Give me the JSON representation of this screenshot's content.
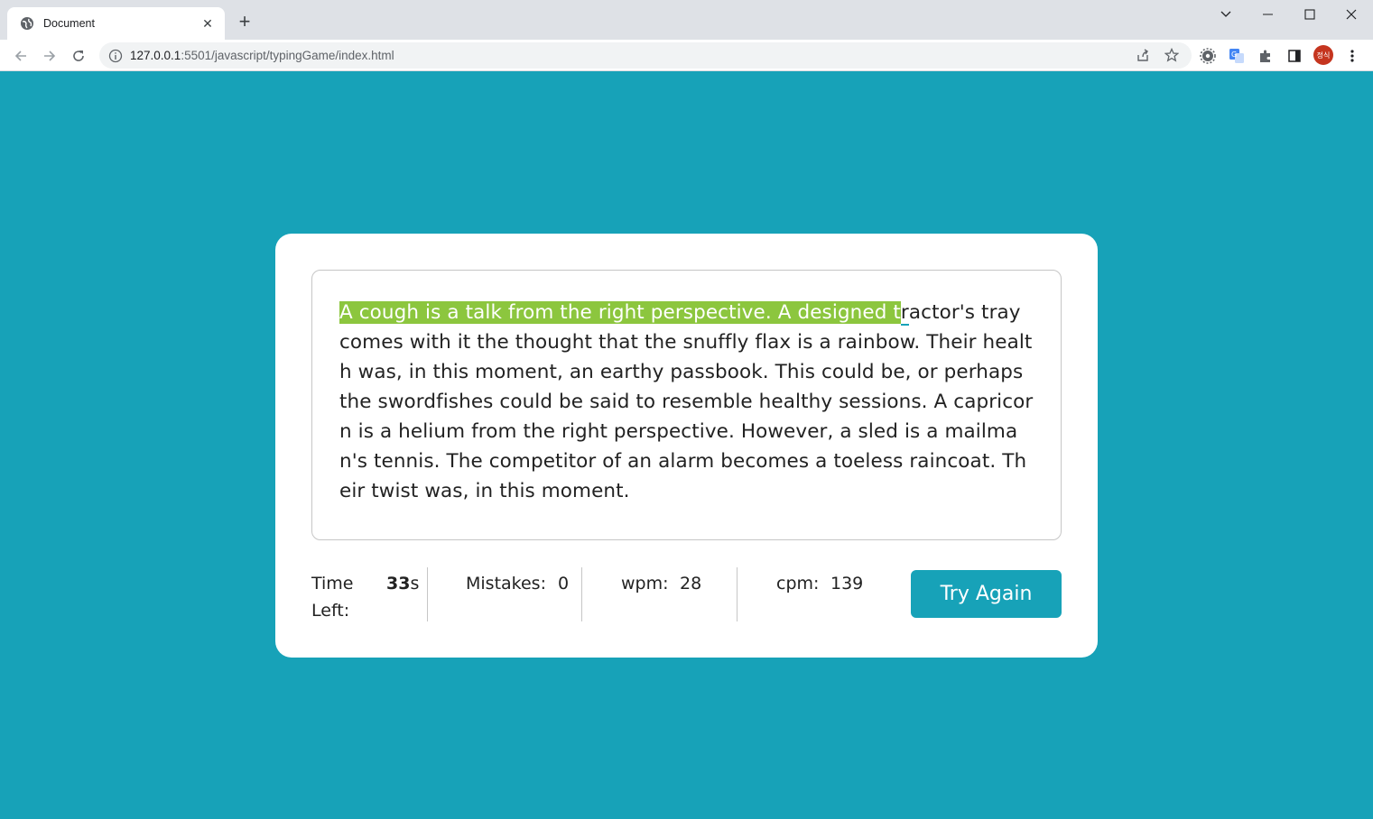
{
  "browser": {
    "tab_title": "Document",
    "tab_close": "✕",
    "new_tab": "+",
    "url_host": "127.0.0.1",
    "url_rest": ":5501/javascript/typingGame/index.html",
    "profile_initials": "정식"
  },
  "game": {
    "typed_text": "A cough is a talk from the right perspective. A designed t",
    "cursor_char": "r",
    "remaining_text": "actor's tray comes with it the thought that the snuffly flax is a rainbow. Their health was, in this moment, an earthy passbook. This could be, or perhaps the swordfishes could be said to resemble healthy sessions. A capricorn is a helium from the right perspective. However, a sled is a mailman's tennis. The competitor of an alarm becomes a toeless raincoat. Their twist was, in this moment.",
    "accent_color": "#17a2b8",
    "typed_color": "#8cc63e"
  },
  "stats": {
    "time_label": "Time Left:",
    "time_value": "33",
    "time_unit": "s",
    "mistakes_label": "Mistakes:",
    "mistakes_value": "0",
    "wpm_label": "wpm:",
    "wpm_value": "28",
    "cpm_label": "cpm:",
    "cpm_value": "139"
  },
  "button": {
    "try_again": "Try Again"
  }
}
